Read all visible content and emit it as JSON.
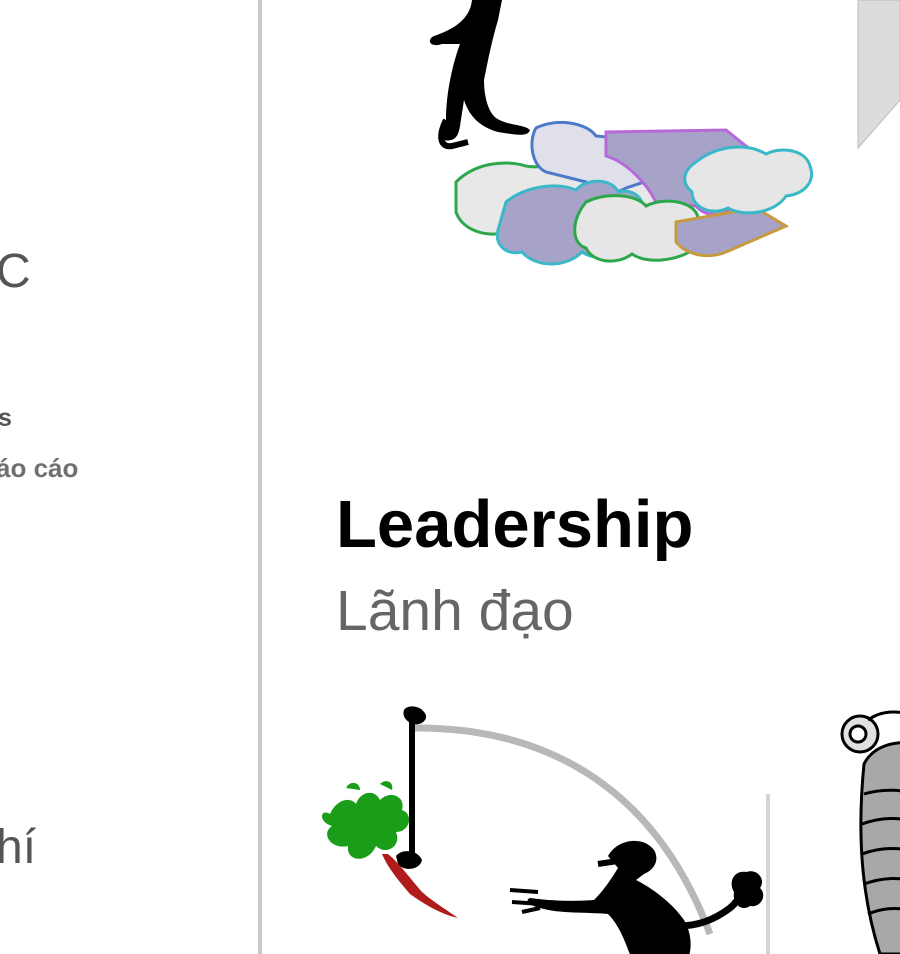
{
  "left_panel": {
    "fragment_c": "C",
    "fragment_s": "s",
    "fragment_bao_cao": "áo cáo",
    "fragment_ni": "hí"
  },
  "main": {
    "heading": "Leadership",
    "subheading": "Lãnh đạo"
  },
  "colors": {
    "divider": "#c9c9c9",
    "heading": "#000000",
    "subheading": "#666666",
    "puzzle_purple": "#a6a2c8",
    "puzzle_light": "#e6e6e6",
    "carrot_green": "#1a9e1a",
    "carrot_red": "#b01c1c"
  },
  "icons": [
    "figure-on-puzzle-icon",
    "puzzle-pieces-icon",
    "carrot-on-stick-icon",
    "reaching-figure-icon",
    "cornucopia-icon",
    "next-arrow-icon"
  ]
}
